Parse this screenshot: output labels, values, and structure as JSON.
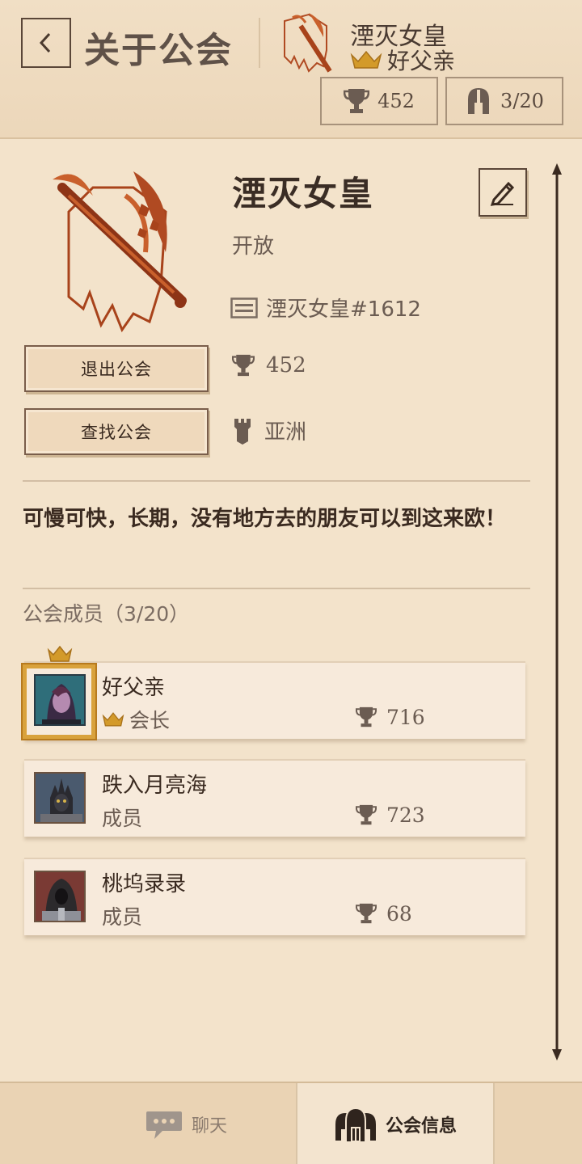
{
  "header": {
    "title": "关于公会",
    "guild_name": "湮灭女皇",
    "leader_name": "好父亲",
    "trophies": "452",
    "members": "3/20"
  },
  "guild": {
    "name": "湮灭女皇",
    "status": "开放",
    "id": "湮灭女皇#1612",
    "trophies": "452",
    "region": "亚洲",
    "description": "可慢可快，长期，没有地方去的朋友可以到这来欧！",
    "leave_label": "退出公会",
    "find_label": "查找公会"
  },
  "members_section": {
    "title": "公会成员（3/20）",
    "members": [
      {
        "name": "好父亲",
        "role": "会长",
        "trophies": "716",
        "leader": true
      },
      {
        "name": "跌入月亮海",
        "role": "成员",
        "trophies": "723",
        "leader": false
      },
      {
        "name": "桃坞录录",
        "role": "成员",
        "trophies": "68",
        "leader": false
      }
    ]
  },
  "nav": {
    "chat_label": "聊天",
    "guild_info_label": "公会信息"
  },
  "colors": {
    "background": "#efdcc2",
    "accent_gold": "#d9a23c",
    "emblem_red": "#a8431b"
  }
}
